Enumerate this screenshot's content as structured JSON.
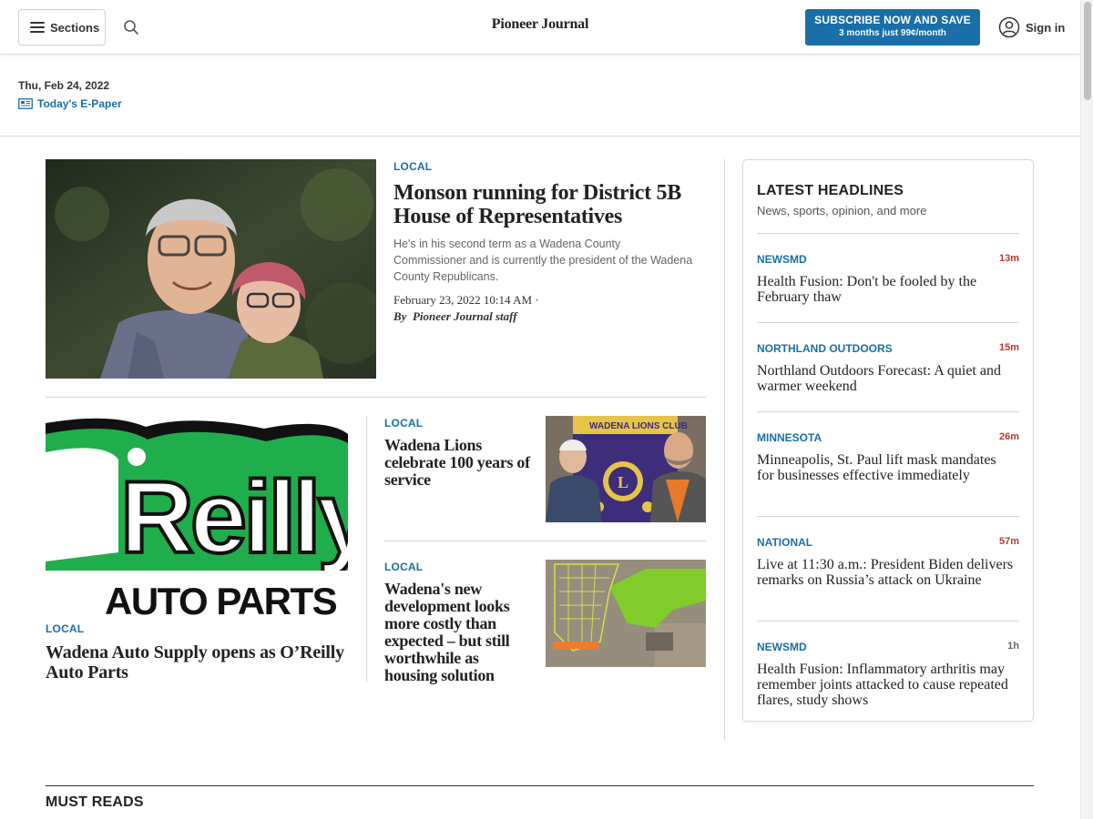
{
  "header": {
    "sections_label": "Sections",
    "logo_text": "Pioneer Journal",
    "subscribe_title": "SUBSCRIBE NOW AND SAVE",
    "subscribe_offer": "3 months just 99¢/month",
    "signin_label": "Sign in"
  },
  "datebar": {
    "date": "Thu, Feb 24, 2022",
    "epaper_label": "Today's E-Paper"
  },
  "lead_story": {
    "kicker": "LOCAL",
    "title": "Monson running for District 5B House of Representatives",
    "summary": "He's in his second term as a Wadena County Commissioner and is currently the president of the Wadena County Republicans.",
    "date": "February 23, 2022 10:14 AM ·",
    "byline_prefix": "By",
    "byline_author": "Pioneer Journal staff"
  },
  "oreilly_story": {
    "kicker": "LOCAL",
    "title": "Wadena Auto Supply opens as O’Reilly Auto Parts",
    "logo_word": "Reilly",
    "logo_sub": "AUTO PARTS"
  },
  "small_stories": [
    {
      "kicker": "LOCAL",
      "title": "Wadena Lions celebrate 100 years of service",
      "banner_text": "WADENA LIONS CLUB",
      "emblem_letter": "L"
    },
    {
      "kicker": "LOCAL",
      "title": "Wadena's new development looks more costly than expected – but still worthwhile as housing solution"
    }
  ],
  "latest": {
    "title": "LATEST HEADLINES",
    "subtitle": "News, sports, opinion, and more",
    "items": [
      {
        "kicker": "NEWSMD",
        "time": "13m",
        "title": "Health Fusion: Don't be fooled by the February thaw"
      },
      {
        "kicker": "NORTHLAND OUTDOORS",
        "time": "15m",
        "title": "Northland Outdoors Forecast: A quiet and warmer weekend"
      },
      {
        "kicker": "MINNESOTA",
        "time": "26m",
        "title": "Minneapolis, St. Paul lift mask mandates for businesses effective immediately"
      },
      {
        "kicker": "NATIONAL",
        "time": "57m",
        "title": "Live at 11:30 a.m.: President Biden delivers remarks on Russia’s attack on Ukraine"
      },
      {
        "kicker": "NEWSMD",
        "time": "1h",
        "title": "Health Fusion: Inflammatory arthritis may remember joints attacked to cause repeated flares, study shows"
      }
    ]
  },
  "must_reads": {
    "title": "MUST READS"
  },
  "colors": {
    "accent_blue": "#1a6fa8",
    "time_red": "#c0392b",
    "oreilly_green": "#1fae4b"
  }
}
